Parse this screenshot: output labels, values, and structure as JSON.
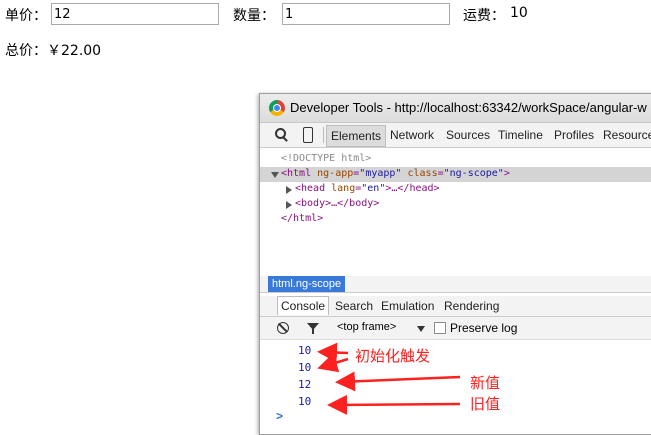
{
  "form": {
    "price_label": "单价：",
    "price_value": "12",
    "qty_label": "数量：",
    "qty_value": "1",
    "freight_label": "运费：",
    "freight_value": "10",
    "total_label": "总价：",
    "total_value": "￥22.00"
  },
  "devtools": {
    "window_title": "Developer Tools - http://localhost:63342/workSpace/angular-w",
    "tabs": [
      "Elements",
      "Network",
      "Sources",
      "Timeline",
      "Profiles",
      "Resource"
    ],
    "active_tab": "Elements",
    "dom": {
      "doctype": "<!DOCTYPE html>",
      "html_open_tag": "<html",
      "html_attr1_name": "ng-app",
      "html_attr1_value": "\"myapp\"",
      "html_attr2_name": "class",
      "html_attr2_value": "\"ng-scope\"",
      "head_open": "<head",
      "head_attr_name": "lang",
      "head_attr_value": "\"en\"",
      "head_rest": ">…</head>",
      "body_line": "<body>…</body>",
      "html_close": "</html>"
    },
    "breadcrumb": "html.ng-scope",
    "console_tabs": [
      "Console",
      "Search",
      "Emulation",
      "Rendering"
    ],
    "frame_selector": "<top frame>",
    "preserve_log_label": "Preserve log",
    "preserve_log_checked": false,
    "console_logs": [
      "10",
      "10",
      "12",
      "10"
    ],
    "prompt": ">"
  },
  "annotations": {
    "init": "初始化触发",
    "new_value": "新值",
    "old_value": "旧值",
    "color": "#ff2020"
  }
}
